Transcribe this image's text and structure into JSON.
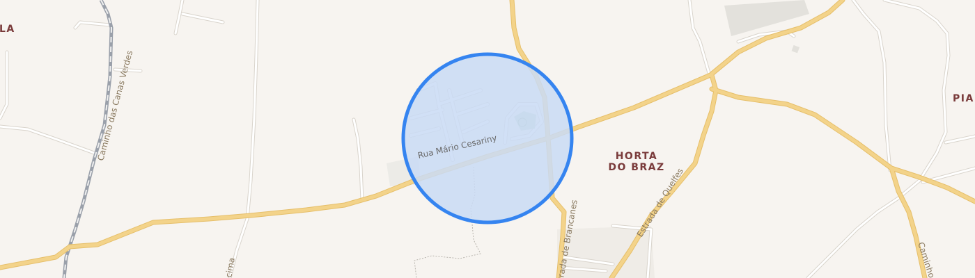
{
  "map": {
    "background": "#f7f4f0",
    "colors": {
      "major_road": "#f3d38a",
      "major_road_casing": "#e6bf6a",
      "minor_road": "#ffffff",
      "minor_road_casing": "#d9d4cc",
      "railway": "#9aa0aa",
      "highlight_fill": "#c9dbf5",
      "highlight_stroke": "#3584f0",
      "park": "#c9dcc7",
      "building": "#e3e1dc",
      "label_place": "#7a3b3b"
    },
    "places": {
      "horta_line1": "HORTA",
      "horta_line2": "DO BRAZ",
      "piar": "PIAR",
      "la": "LA"
    },
    "streets": {
      "rua_mario_cesariny": "Rua Mário Cesariny",
      "caminho_canas_verdes": "Caminho das Canas Verdes",
      "estrada_quelfes": "Estrada de Quelfes",
      "estrada_brancanes": "Estrada de Brancanes",
      "caminho_right": "Caminho",
      "cima_fragment": "cima"
    }
  }
}
